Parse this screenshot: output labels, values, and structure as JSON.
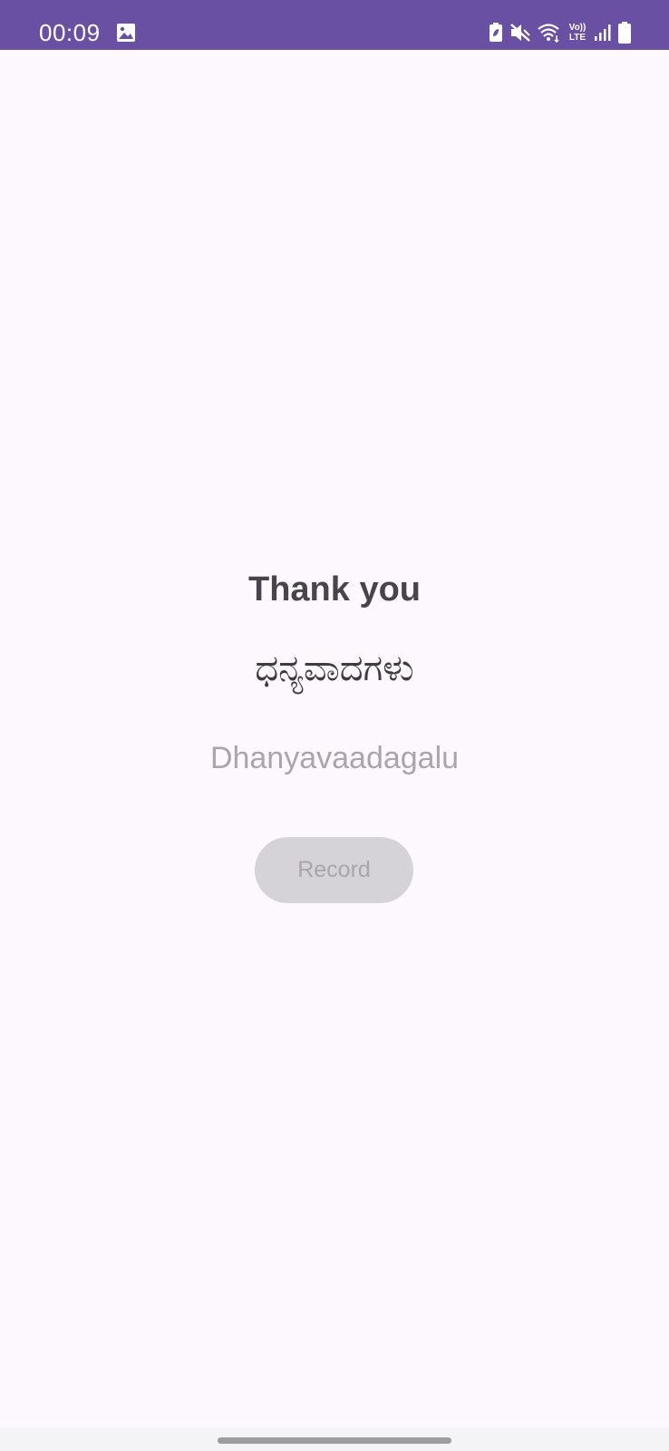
{
  "status_bar": {
    "time": "00:09",
    "left_icons": [
      "image-icon"
    ],
    "right_icons": [
      "battery-saver-icon",
      "mute-icon",
      "wifi-icon",
      "volte-icon",
      "signal-icon",
      "battery-icon"
    ],
    "volte_line1": "Vo))",
    "volte_line2": "LTE",
    "color": "#6a50a2"
  },
  "main": {
    "title": "Thank you",
    "native_text": "ಧನ್ಯವಾದಗಳು",
    "transliteration": "Dhanyavaadagalu",
    "record_button_label": "Record",
    "record_button_state": "disabled"
  },
  "colors": {
    "background": "#fdf8fd",
    "status_bar": "#6a50a2",
    "button_disabled": "#d6d3d8"
  }
}
